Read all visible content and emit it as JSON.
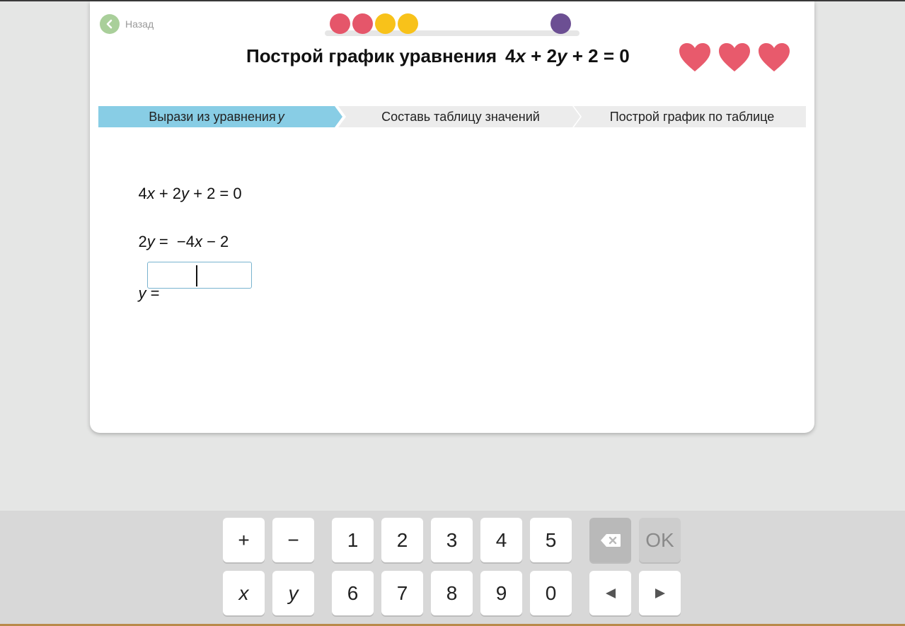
{
  "header": {
    "back_label": "Назад",
    "title_text": "Построй график уравнения",
    "equation": {
      "t1": "4",
      "v1": "x",
      "t2": " + 2",
      "v2": "y",
      "t3": " + 2 = 0"
    },
    "lives": 3,
    "progress_dots": [
      "#e5566a",
      "#e5566a",
      "#f8c21a",
      "#f8c21a",
      "#6c4f93"
    ]
  },
  "steps": [
    {
      "label": "Вырази из уравнения ",
      "var": "y",
      "active": true
    },
    {
      "label": "Составь таблицу значений",
      "active": false
    },
    {
      "label": "Построй график по таблице",
      "active": false
    }
  ],
  "work": {
    "line1": {
      "a": "4",
      "v1": "x",
      "b": " + 2",
      "v2": "y",
      "c": " + 2 = 0"
    },
    "line2": {
      "a": "2",
      "v1": "y",
      "b": " =  −4",
      "v2": "x",
      "c": " − 2"
    },
    "line3": {
      "v": "y",
      "eq": " ="
    },
    "input_value": ""
  },
  "keypad": {
    "plus": "+",
    "minus": "−",
    "digits_row1": [
      "1",
      "2",
      "3",
      "4",
      "5"
    ],
    "digits_row2": [
      "6",
      "7",
      "8",
      "9",
      "0"
    ],
    "var_x": "x",
    "var_y": "y",
    "ok": "OK",
    "backspace_icon": "backspace-icon",
    "left_icon": "arrow-left-icon",
    "right_icon": "arrow-right-icon"
  },
  "colors": {
    "active_step": "#88cde5",
    "inactive_step": "#ececec",
    "heart": "#e85a6c",
    "back_button": "#a9cf9a"
  }
}
